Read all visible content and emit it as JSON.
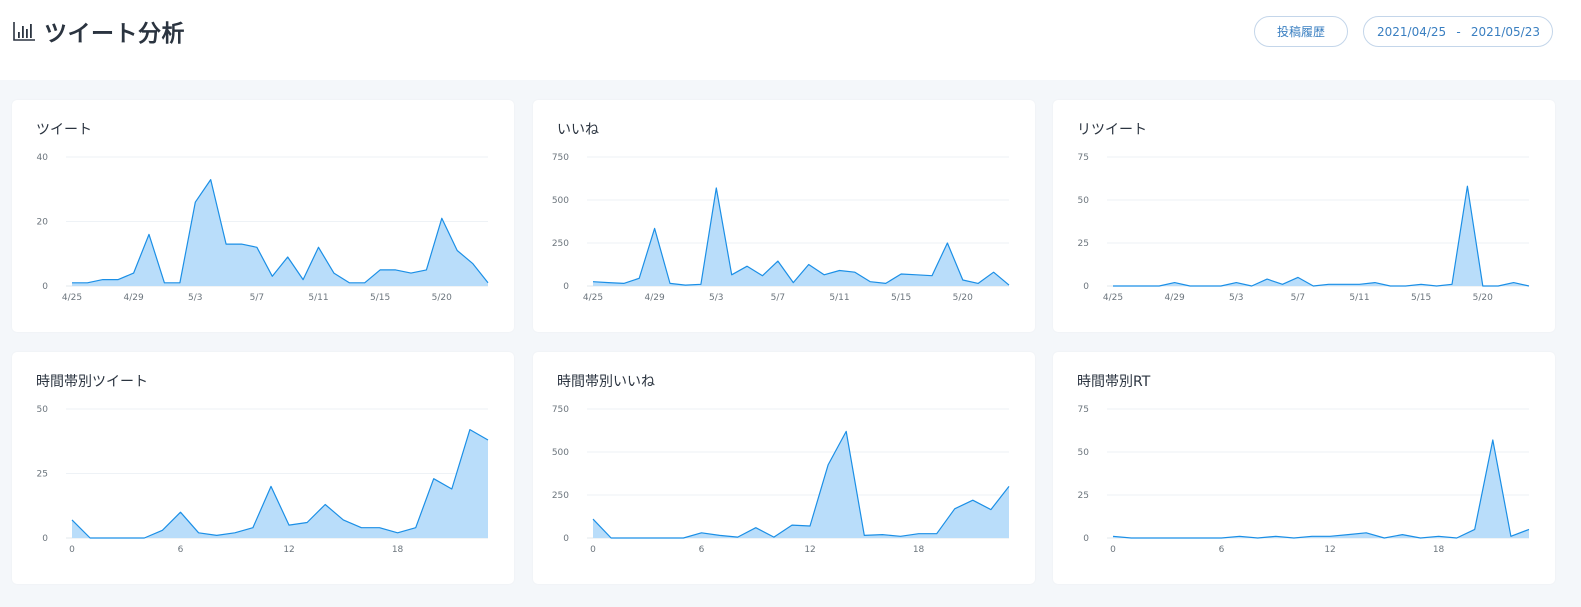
{
  "header": {
    "title": "ツイート分析",
    "history_button": "投稿履歴",
    "date_from": "2021/04/25",
    "date_sep": "-",
    "date_to": "2021/05/23"
  },
  "colors": {
    "accent": "#1b8fe6",
    "area_fill": "#b9ddfa",
    "button_text": "#3a7fc1"
  },
  "icons": {
    "title": "bar-chart-icon"
  },
  "chart_data": [
    {
      "type": "area",
      "title": "ツイート",
      "x": [
        "4/25",
        "4/26",
        "4/27",
        "4/28",
        "4/29",
        "4/30",
        "5/1",
        "5/2",
        "5/3",
        "5/4",
        "5/5",
        "5/6",
        "5/7",
        "5/8",
        "5/9",
        "5/10",
        "5/11",
        "5/12",
        "5/13",
        "5/14",
        "5/15",
        "5/16",
        "5/17",
        "5/18",
        "5/20",
        "5/21",
        "5/22",
        "5/23"
      ],
      "values": [
        1,
        1,
        2,
        2,
        4,
        16,
        1,
        1,
        26,
        33,
        13,
        13,
        12,
        3,
        9,
        2,
        12,
        4,
        1,
        1,
        5,
        5,
        4,
        5,
        21,
        11,
        7,
        1
      ],
      "x_tick_labels": [
        "4/25",
        "4/29",
        "5/3",
        "5/7",
        "5/11",
        "5/15",
        "5/20"
      ],
      "x_tick_index": [
        0,
        4,
        8,
        12,
        16,
        20,
        24
      ],
      "y_ticks": [
        "0",
        "20",
        "40"
      ],
      "ylim": [
        0,
        40
      ]
    },
    {
      "type": "area",
      "title": "いいね",
      "x": [
        "4/25",
        "4/26",
        "4/27",
        "4/28",
        "4/29",
        "4/30",
        "5/1",
        "5/2",
        "5/3",
        "5/4",
        "5/5",
        "5/6",
        "5/7",
        "5/8",
        "5/9",
        "5/10",
        "5/11",
        "5/12",
        "5/13",
        "5/14",
        "5/15",
        "5/16",
        "5/17",
        "5/18",
        "5/20",
        "5/21",
        "5/22",
        "5/23"
      ],
      "values": [
        25,
        20,
        15,
        45,
        335,
        15,
        5,
        10,
        570,
        65,
        115,
        60,
        145,
        20,
        125,
        65,
        90,
        80,
        25,
        15,
        70,
        65,
        60,
        250,
        35,
        15,
        80,
        5
      ],
      "x_tick_labels": [
        "4/25",
        "4/29",
        "5/3",
        "5/7",
        "5/11",
        "5/15",
        "5/20"
      ],
      "x_tick_index": [
        0,
        4,
        8,
        12,
        16,
        20,
        24
      ],
      "y_ticks": [
        "0",
        "250",
        "500",
        "750"
      ],
      "ylim": [
        0,
        750
      ]
    },
    {
      "type": "area",
      "title": "リツイート",
      "x": [
        "4/25",
        "4/26",
        "4/27",
        "4/28",
        "4/29",
        "4/30",
        "5/1",
        "5/2",
        "5/3",
        "5/4",
        "5/5",
        "5/6",
        "5/7",
        "5/8",
        "5/9",
        "5/10",
        "5/11",
        "5/12",
        "5/13",
        "5/14",
        "5/15",
        "5/16",
        "5/17",
        "5/18",
        "5/20",
        "5/21",
        "5/22",
        "5/23"
      ],
      "values": [
        0,
        0,
        0,
        0,
        2,
        0,
        0,
        0,
        2,
        0,
        4,
        1,
        5,
        0,
        1,
        1,
        1,
        2,
        0,
        0,
        1,
        0,
        1,
        58,
        0,
        0,
        2,
        0
      ],
      "x_tick_labels": [
        "4/25",
        "4/29",
        "5/3",
        "5/7",
        "5/11",
        "5/15",
        "5/20"
      ],
      "x_tick_index": [
        0,
        4,
        8,
        12,
        16,
        20,
        24
      ],
      "y_ticks": [
        "0",
        "25",
        "50",
        "75"
      ],
      "ylim": [
        0,
        75
      ]
    },
    {
      "type": "area",
      "title": "時間帯別ツイート",
      "x": [
        0,
        1,
        2,
        3,
        4,
        5,
        6,
        7,
        8,
        9,
        10,
        11,
        12,
        13,
        14,
        15,
        16,
        17,
        18,
        19,
        20,
        21,
        22,
        23
      ],
      "values": [
        7,
        0,
        0,
        0,
        0,
        3,
        10,
        2,
        1,
        2,
        4,
        20,
        5,
        6,
        13,
        7,
        4,
        4,
        2,
        4,
        23,
        19,
        42,
        38
      ],
      "x_tick_labels": [
        "0",
        "6",
        "12",
        "18"
      ],
      "x_tick_index": [
        0,
        6,
        12,
        18
      ],
      "y_ticks": [
        "0",
        "25",
        "50"
      ],
      "ylim": [
        0,
        50
      ]
    },
    {
      "type": "area",
      "title": "時間帯別いいね",
      "x": [
        0,
        1,
        2,
        3,
        4,
        5,
        6,
        7,
        8,
        9,
        10,
        11,
        12,
        13,
        14,
        15,
        16,
        17,
        18,
        19,
        20,
        21,
        22,
        23
      ],
      "values": [
        110,
        0,
        0,
        0,
        0,
        0,
        30,
        15,
        5,
        60,
        5,
        75,
        70,
        425,
        620,
        15,
        20,
        10,
        25,
        25,
        170,
        220,
        165,
        300
      ],
      "x_tick_labels": [
        "0",
        "6",
        "12",
        "18"
      ],
      "x_tick_index": [
        0,
        6,
        12,
        18
      ],
      "y_ticks": [
        "0",
        "250",
        "500",
        "750"
      ],
      "ylim": [
        0,
        750
      ]
    },
    {
      "type": "area",
      "title": "時間帯別RT",
      "x": [
        0,
        1,
        2,
        3,
        4,
        5,
        6,
        7,
        8,
        9,
        10,
        11,
        12,
        13,
        14,
        15,
        16,
        17,
        18,
        19,
        20,
        21,
        22,
        23
      ],
      "values": [
        1,
        0,
        0,
        0,
        0,
        0,
        0,
        1,
        0,
        1,
        0,
        1,
        1,
        2,
        3,
        0,
        2,
        0,
        1,
        0,
        5,
        57,
        1,
        5
      ],
      "x_tick_labels": [
        "0",
        "6",
        "12",
        "18"
      ],
      "x_tick_index": [
        0,
        6,
        12,
        18
      ],
      "y_ticks": [
        "0",
        "25",
        "50",
        "75"
      ],
      "ylim": [
        0,
        75
      ]
    }
  ]
}
